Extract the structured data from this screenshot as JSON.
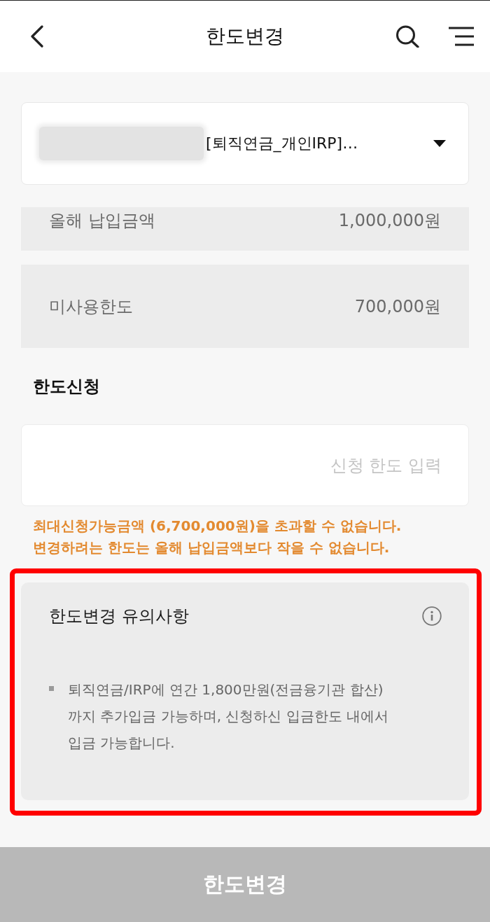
{
  "header": {
    "title": "한도변경"
  },
  "account": {
    "masked": true,
    "name": "[퇴직연금_개인IRP]…"
  },
  "summary_rows": [
    {
      "label": "올해 납입금액",
      "value": "1,000,000원"
    },
    {
      "label": "미사용한도",
      "value": "700,000원"
    }
  ],
  "request": {
    "title": "한도신청",
    "placeholder": "신청 한도 입력"
  },
  "warnings": [
    "최대신청가능금액 (6,700,000원)을 초과할 수 없습니다.",
    "변경하려는 한도는 올해 납입금액보다 작을 수 없습니다."
  ],
  "notice": {
    "title": "한도변경 유의사항",
    "highlighted": true,
    "items": [
      "퇴직연금/IRP에 연간 1,800만원(전금융기관 합산) 까지 추가입금 가능하며, 신청하신 입금한도 내에서 입금 가능합니다."
    ]
  },
  "submit_button": {
    "label": "한도변경",
    "disabled": true
  }
}
